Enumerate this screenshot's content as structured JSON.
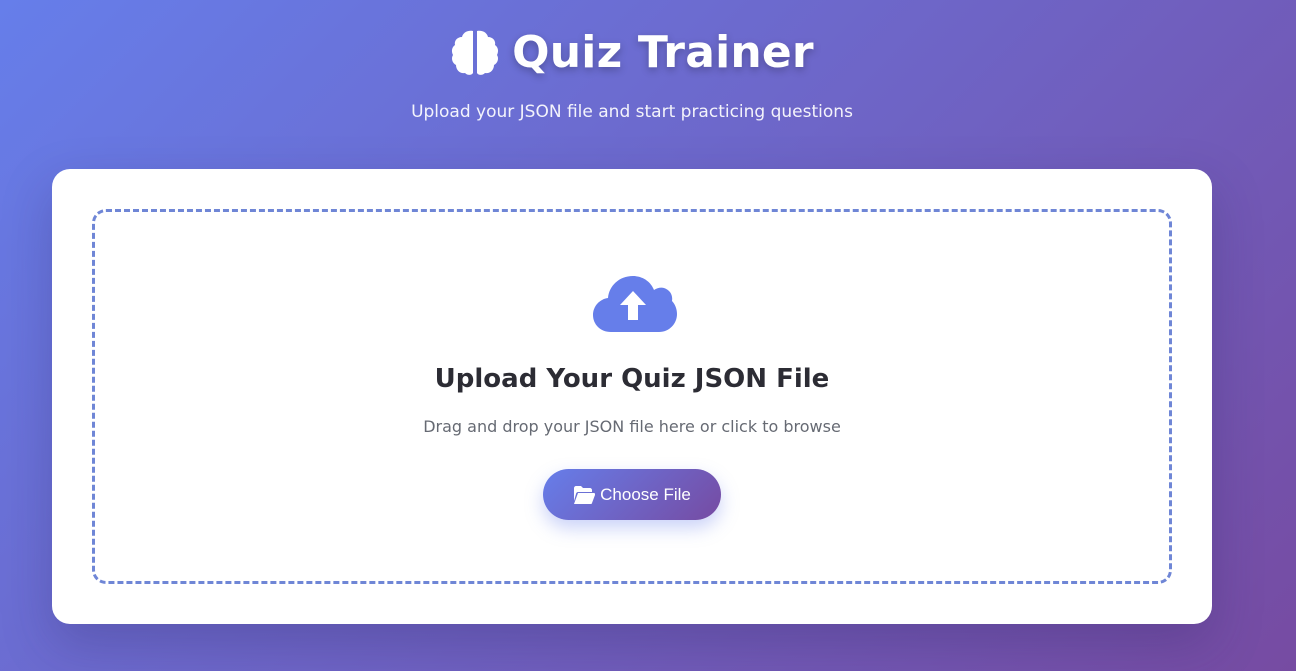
{
  "header": {
    "title": "Quiz Trainer",
    "title_icon": "brain-icon",
    "subtitle": "Upload your JSON file and start practicing questions"
  },
  "upload": {
    "icon": "cloud-upload-icon",
    "title": "Upload Your Quiz JSON File",
    "hint": "Drag and drop your JSON file here or click to browse",
    "button_label": "Choose File",
    "button_icon": "folder-open-icon"
  },
  "colors": {
    "gradient_start": "#667eea",
    "gradient_end": "#764ba2",
    "accent": "#6f86d6"
  }
}
